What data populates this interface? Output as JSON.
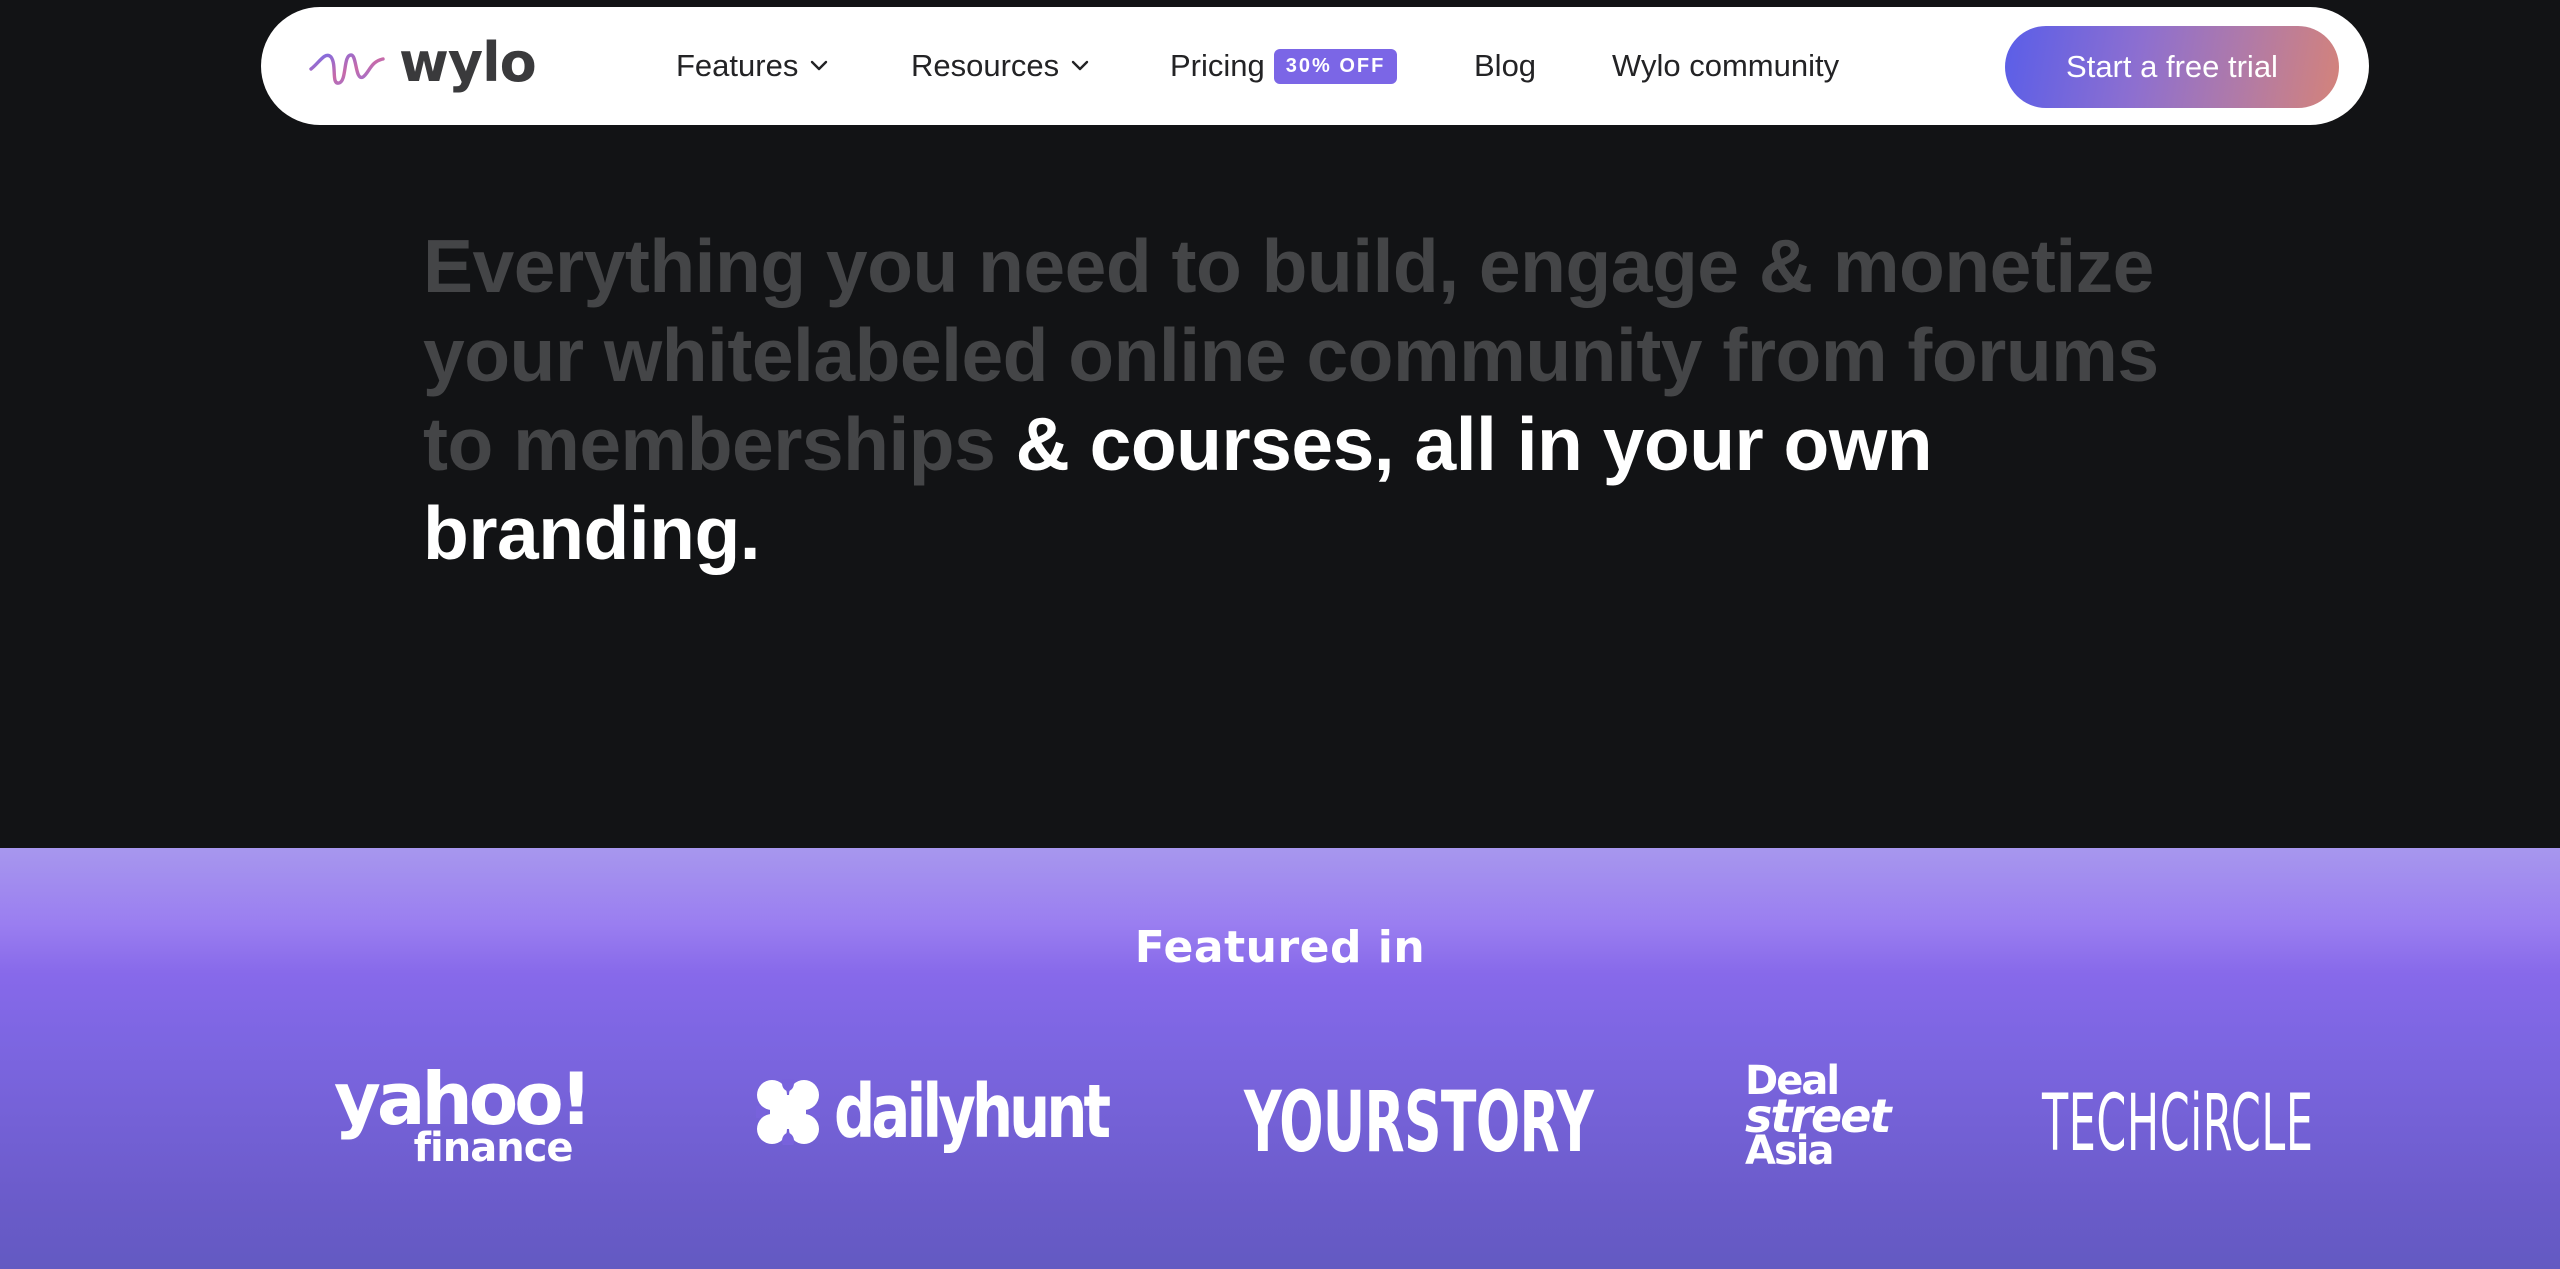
{
  "nav": {
    "logo": {
      "text": "wylo",
      "icon": "wylo-wave-logo-icon"
    },
    "items": [
      {
        "label": "Features",
        "has_dropdown": true,
        "icon": "chevron-down-icon"
      },
      {
        "label": "Resources",
        "has_dropdown": true,
        "icon": "chevron-down-icon"
      },
      {
        "label": "Pricing",
        "badge": "30% OFF"
      },
      {
        "label": "Blog"
      },
      {
        "label": "Wylo community"
      }
    ],
    "cta_label": "Start a free trial"
  },
  "hero": {
    "muted_text": "Everything you need to build, engage & monetize your whitelabeled online community from forums to memberships",
    "highlight_text": " & courses, all in your own branding."
  },
  "featured": {
    "title": "Featured in",
    "logos": [
      {
        "name": "yahoo finance",
        "line1": "yahoo!",
        "line2": "finance"
      },
      {
        "name": "dailyhunt",
        "text": "dailyhunt",
        "icon": "dailyhunt-clover-icon"
      },
      {
        "name": "YourStory",
        "text": "YOURSTORY"
      },
      {
        "name": "DealStreetAsia",
        "line1": "Deal",
        "line2": "street",
        "line3": "Asia"
      },
      {
        "name": "TechCircle",
        "text": "TECHCiRCLE"
      }
    ]
  },
  "colors": {
    "page_bg": "#121315",
    "nav_bg": "#ffffff",
    "badge_bg": "#7b66e6",
    "hero_muted": "#444547",
    "hero_highlight": "#ffffff",
    "cta_gradient_start": "#5a5ee8",
    "cta_gradient_end": "#d4837a",
    "featured_gradient_top": "#a797ee",
    "featured_gradient_bottom": "#635ac2"
  }
}
